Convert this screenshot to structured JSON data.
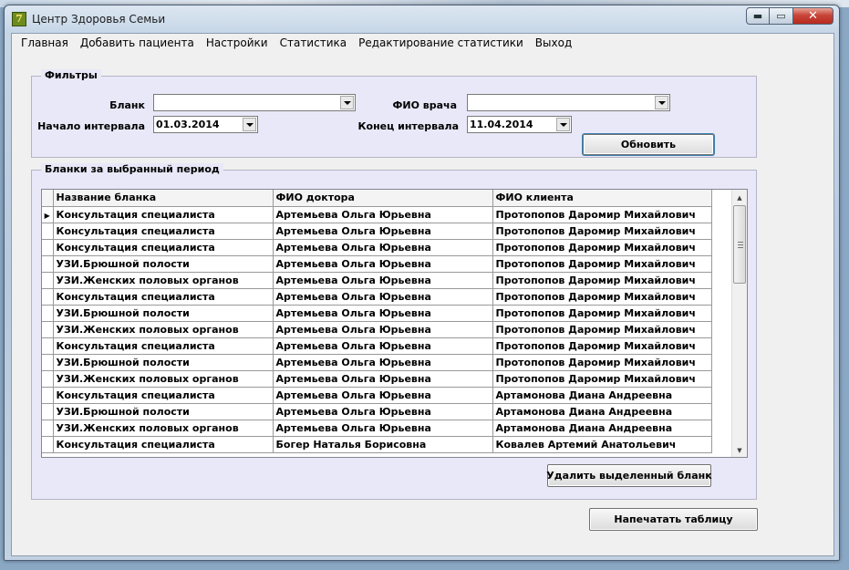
{
  "window": {
    "title": "Центр Здоровья Семьи",
    "app_icon_glyph": "7"
  },
  "caption_buttons": {
    "minimize": "▬",
    "maximize": "▭",
    "close": "✕"
  },
  "menu": [
    "Главная",
    "Добавить пациента",
    "Настройки",
    "Статистика",
    "Редактирование статистики",
    "Выход"
  ],
  "filters": {
    "legend": "Фильтры",
    "blank_label": "Бланк",
    "blank_value": "",
    "doctor_label": "ФИО врача",
    "doctor_value": "",
    "start_label": "Начало интервала",
    "start_value": "01.03.2014",
    "end_label": "Конец интервала",
    "end_value": "11.04.2014",
    "refresh_button": "Обновить"
  },
  "forms_group": {
    "legend": "Бланки за выбранный период",
    "columns": [
      "Название бланка",
      "ФИО доктора",
      "ФИО клиента"
    ],
    "current_row_marker": "▶",
    "rows": [
      [
        "Консультация специалиста",
        "Артемьева Ольга Юрьевна",
        "Протопопов Даромир Михайлович"
      ],
      [
        "Консультация специалиста",
        "Артемьева Ольга Юрьевна",
        "Протопопов Даромир Михайлович"
      ],
      [
        "Консультация специалиста",
        "Артемьева Ольга Юрьевна",
        "Протопопов Даромир Михайлович"
      ],
      [
        "УЗИ.Брюшной полости",
        "Артемьева Ольга Юрьевна",
        "Протопопов Даромир Михайлович"
      ],
      [
        "УЗИ.Женских половых органов",
        "Артемьева Ольга Юрьевна",
        "Протопопов Даромир Михайлович"
      ],
      [
        "Консультация специалиста",
        "Артемьева Ольга Юрьевна",
        "Протопопов Даромир Михайлович"
      ],
      [
        "УЗИ.Брюшной полости",
        "Артемьева Ольга Юрьевна",
        "Протопопов Даромир Михайлович"
      ],
      [
        "УЗИ.Женских половых органов",
        "Артемьева Ольга Юрьевна",
        "Протопопов Даромир Михайлович"
      ],
      [
        "Консультация специалиста",
        "Артемьева Ольга Юрьевна",
        "Протопопов Даромир Михайлович"
      ],
      [
        "УЗИ.Брюшной полости",
        "Артемьева Ольга Юрьевна",
        "Протопопов Даромир Михайлович"
      ],
      [
        "УЗИ.Женских половых органов",
        "Артемьева Ольга Юрьевна",
        "Протопопов Даромир Михайлович"
      ],
      [
        "Консультация специалиста",
        "Артемьева Ольга Юрьевна",
        "Артамонова Диана Андреевна"
      ],
      [
        "УЗИ.Брюшной полости",
        "Артемьева Ольга Юрьевна",
        "Артамонова Диана Андреевна"
      ],
      [
        "УЗИ.Женских половых органов",
        "Артемьева Ольга Юрьевна",
        "Артамонова Диана Андреевна"
      ],
      [
        "Консультация специалиста",
        "Богер Наталья Борисовна",
        "Ковалев Артемий Анатольевич"
      ]
    ],
    "delete_button": "Удалить выделенный бланк"
  },
  "print_button": "Напечатать таблицу",
  "scroll_icons": {
    "up": "▲",
    "down": "▼"
  }
}
